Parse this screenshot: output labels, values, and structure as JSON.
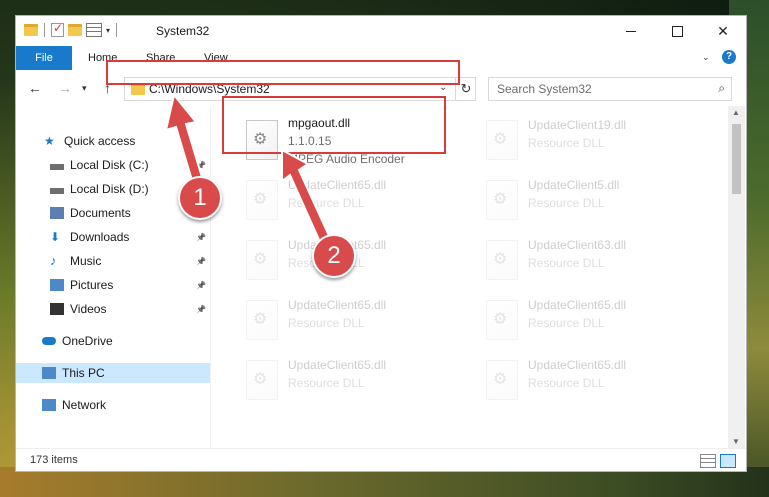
{
  "window": {
    "title": "System32"
  },
  "window_controls": {
    "minimize": "",
    "maximize": "",
    "close": "✕"
  },
  "ribbon": {
    "file": "File",
    "home": "Home",
    "share": "Share",
    "view": "View",
    "help": "?"
  },
  "address_bar": {
    "path": "C:\\Windows\\System32",
    "search_placeholder": "Search System32"
  },
  "sidebar": {
    "items": [
      {
        "label": "Quick access",
        "icon": "star-icon",
        "color": "#1979ca",
        "pinned": false
      },
      {
        "label": "Local Disk (C:)",
        "icon": "drive-icon",
        "color": "#6d6d6d",
        "pinned": true
      },
      {
        "label": "Local Disk (D:)",
        "icon": "drive-icon",
        "color": "#6d6d6d",
        "pinned": true
      },
      {
        "label": "Documents",
        "icon": "documents-icon",
        "color": "#5b7fb0",
        "pinned": true
      },
      {
        "label": "Downloads",
        "icon": "download-icon",
        "color": "#1979ca",
        "pinned": true
      },
      {
        "label": "Music",
        "icon": "music-icon",
        "color": "#1979ca",
        "pinned": true
      },
      {
        "label": "Pictures",
        "icon": "pictures-icon",
        "color": "#4c89c9",
        "pinned": true
      },
      {
        "label": "Videos",
        "icon": "videos-icon",
        "color": "#333333",
        "pinned": true
      },
      {
        "label": "OneDrive",
        "icon": "cloud-icon",
        "color": "#1979ca",
        "pinned": false
      },
      {
        "label": "This PC",
        "icon": "computer-icon",
        "color": "#4c89c9",
        "pinned": false,
        "selected": true
      },
      {
        "label": "Network",
        "icon": "network-icon",
        "color": "#4c89c9",
        "pinned": false
      }
    ]
  },
  "files": [
    {
      "name": "mpgaout.dll",
      "line2": "1.1.0.15",
      "line3": "MPEG Audio Encoder",
      "highlighted": true
    },
    {
      "name": "UpdateClient19.dll",
      "line2": "Resource DLL",
      "faded": true
    },
    {
      "name": "UpdateClient65.dll",
      "line2": "Resource DLL",
      "faded": true
    },
    {
      "name": "UpdateClient5.dll",
      "line2": "Resource DLL",
      "faded": true
    },
    {
      "name": "UpdateClient65.dll",
      "line2": "Resource DLL",
      "faded": true
    },
    {
      "name": "UpdateClient63.dll",
      "line2": "Resource DLL",
      "faded": true
    },
    {
      "name": "UpdateClient65.dll",
      "line2": "Resource DLL",
      "faded": true
    },
    {
      "name": "UpdateClient65.dll",
      "line2": "Resource DLL",
      "faded": true
    },
    {
      "name": "UpdateClient65.dll",
      "line2": "Resource DLL",
      "faded": true
    },
    {
      "name": "UpdateClient65.dll",
      "line2": "Resource DLL",
      "faded": true
    }
  ],
  "status": {
    "items_count": "173 items"
  },
  "callouts": {
    "one": "1",
    "two": "2"
  },
  "colors": {
    "accent": "#1979ca",
    "highlight_red": "#d93a3a",
    "callout_red": "#d94a4a"
  }
}
